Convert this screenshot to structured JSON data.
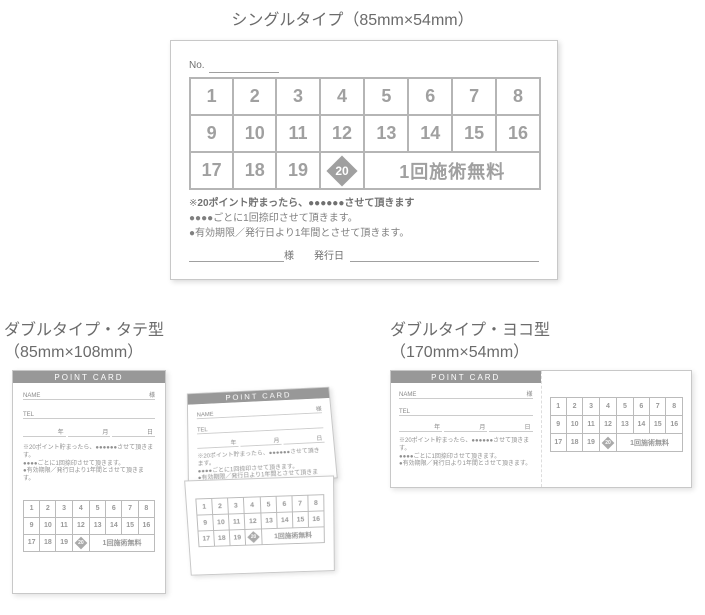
{
  "main": {
    "label": "シングルタイプ（85mm×54mm）",
    "no_label": "No.",
    "grid": {
      "row1": [
        "1",
        "2",
        "3",
        "4",
        "5",
        "6",
        "7",
        "8"
      ],
      "row2": [
        "9",
        "10",
        "11",
        "12",
        "13",
        "14",
        "15",
        "16"
      ],
      "row3_left": [
        "17",
        "18",
        "19"
      ],
      "row3_special": "20",
      "bonus": "1回施術無料"
    },
    "notes": {
      "line1_prefix": "※",
      "line1_bold": "20ポイント貯まったら、●●●●●●させて頂きます",
      "line2": "●●●●ごとに1回捺印させて頂きます。",
      "line3": "●有効期限／発行日より1年間とさせて頂きます。"
    },
    "sign": {
      "sama": "様",
      "issue": "発行日"
    }
  },
  "tate": {
    "label_l1": "ダブルタイプ・タテ型",
    "label_l2": "（85mm×108mm）"
  },
  "yoko": {
    "label_l1": "ダブルタイプ・ヨコ型",
    "label_l2": "（170mm×54mm）"
  },
  "mini": {
    "bar": "POINT CARD",
    "name": "NAME",
    "tel": "TEL",
    "sama": "様",
    "year": "年",
    "month": "月",
    "day": "日",
    "note1": "※20ポイント貯まったら、●●●●●●させて頂きます。",
    "note2": "●●●●ごとに1回捺印させて頂きます。",
    "note3": "●有効期限／発行日より1年間とさせて頂きます。",
    "row1": [
      "1",
      "2",
      "3",
      "4",
      "5",
      "6",
      "7",
      "8"
    ],
    "row2": [
      "9",
      "10",
      "11",
      "12",
      "13",
      "14",
      "15",
      "16"
    ],
    "row3_left": [
      "17",
      "18",
      "19"
    ],
    "row3_special": "20",
    "bonus": "1回施術無料"
  }
}
